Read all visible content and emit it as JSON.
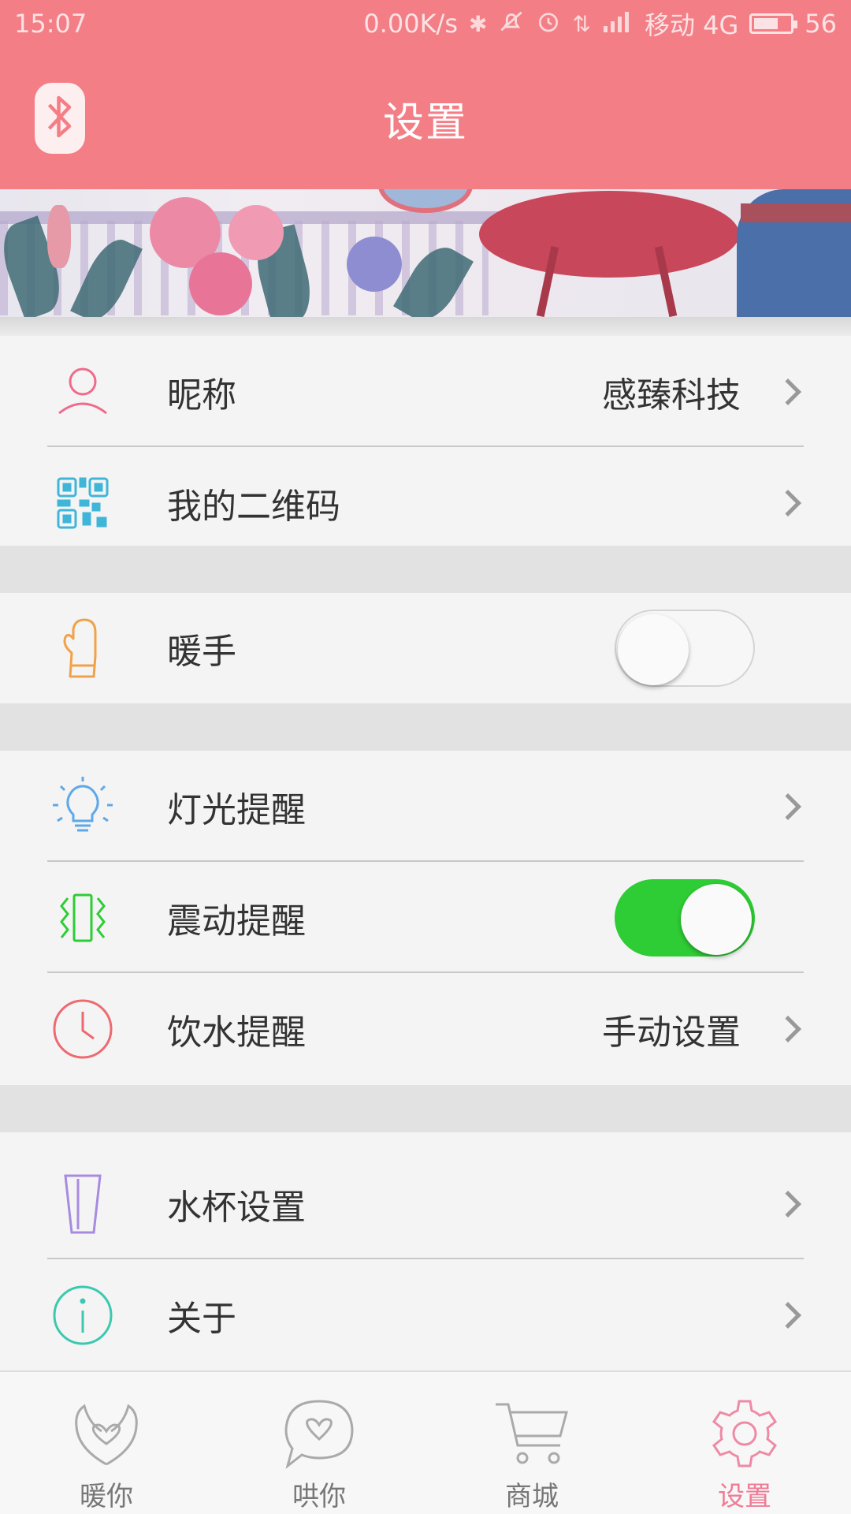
{
  "status_bar": {
    "time": "15:07",
    "speed": "0.00K/s",
    "carrier": "移动 4G",
    "battery": "56"
  },
  "header": {
    "title": "设置",
    "bluetooth_icon": "bluetooth-icon"
  },
  "colors": {
    "brand": "#f47e86",
    "toggle_on": "#2ecc35",
    "active_tab": "#ee7c95"
  },
  "profile": {
    "nickname_label": "昵称",
    "nickname_value": "感臻科技",
    "qrcode_label": "我的二维码"
  },
  "warmer": {
    "label": "暖手",
    "enabled": false
  },
  "reminders": {
    "light_label": "灯光提醒",
    "vibration_label": "震动提醒",
    "vibration_enabled": true,
    "drink_label": "饮水提醒",
    "drink_value": "手动设置"
  },
  "misc": {
    "cup_label": "水杯设置",
    "about_label": "关于"
  },
  "tabs": [
    {
      "label": "暖你",
      "icon": "hands-heart-icon",
      "active": false
    },
    {
      "label": "哄你",
      "icon": "chat-heart-icon",
      "active": false
    },
    {
      "label": "商城",
      "icon": "cart-icon",
      "active": false
    },
    {
      "label": "设置",
      "icon": "gear-icon",
      "active": true
    }
  ]
}
